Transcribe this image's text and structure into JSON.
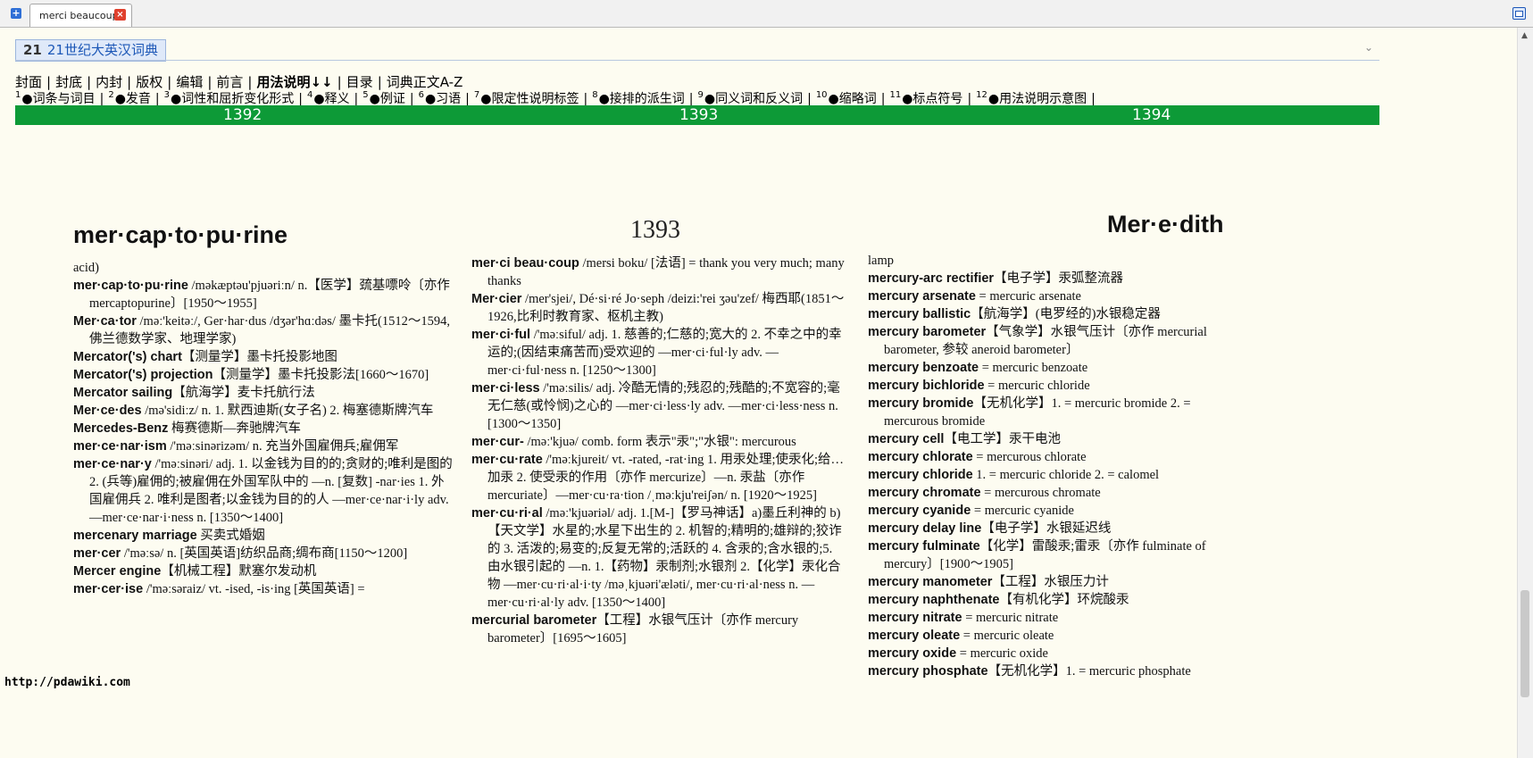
{
  "tab": {
    "label": "merci beaucoup",
    "close_glyph": "×",
    "add_glyph": "+"
  },
  "book": {
    "icon_text": "21",
    "title": "21世纪大英汉词典"
  },
  "nav_main": [
    "封面",
    "封底",
    "内封",
    "版权",
    "编辑",
    "前言",
    "用法说明↓↓",
    "目录",
    "词典正文A-Z"
  ],
  "nav_main_sep": "|",
  "nav_usage": [
    {
      "num": "1",
      "label": "●词条与词目"
    },
    {
      "num": "2",
      "label": "●发音"
    },
    {
      "num": "3",
      "label": "●词性和屈折变化形式"
    },
    {
      "num": "4",
      "label": "●释义"
    },
    {
      "num": "5",
      "label": "●例证"
    },
    {
      "num": "6",
      "label": "●习语"
    },
    {
      "num": "7",
      "label": "●限定性说明标签"
    },
    {
      "num": "8",
      "label": "●接排的派生词"
    },
    {
      "num": "9",
      "label": "●同义词和反义词"
    },
    {
      "num": "10",
      "label": "●缩略词"
    },
    {
      "num": "11",
      "label": "●标点符号"
    },
    {
      "num": "12",
      "label": "●用法说明示意图"
    }
  ],
  "page_numbers": [
    "1392",
    "1393",
    "1394"
  ],
  "pages": [
    {
      "header": "mer·cap·to·pu·rine",
      "entries": [
        {
          "h": "",
          "b": "acid)"
        },
        {
          "h": "mer·cap·to·pu·rine",
          "b": " /məkæptəu'pjuəriːn/ n.【医学】巯基嘌呤〔亦作 mercaptopurine〕[1950～1955]"
        },
        {
          "h": "Mer·ca·tor",
          "b": " /məː'keitəː/, Ger·har·dus /dʒər'hɑːdəs/ 墨卡托(1512～1594,佛兰德数学家、地理学家)"
        },
        {
          "h": "Mercator('s) chart",
          "b": "【测量学】墨卡托投影地图"
        },
        {
          "h": "Mercator('s) projection",
          "b": "【测量学】墨卡托投影法[1660～1670]"
        },
        {
          "h": "Mercator sailing",
          "b": "【航海学】麦卡托航行法"
        },
        {
          "h": "Mer·ce·des",
          "b": " /mə'sidiːz/ n. 1. 默西迪斯(女子名) 2. 梅塞德斯牌汽车"
        },
        {
          "h": "Mercedes-Benz",
          "b": " 梅赛德斯—奔驰牌汽车"
        },
        {
          "h": "mer·ce·nar·ism",
          "b": " /'məːsinərizəm/ n. 充当外国雇佣兵;雇佣军"
        },
        {
          "h": "mer·ce·nar·y",
          "b": " /'məːsinəri/ adj. 1. 以金钱为目的的;贪财的;唯利是图的 2. (兵等)雇佣的;被雇佣在外国军队中的 —n. [复数] -nar·ies 1. 外国雇佣兵 2. 唯利是图者;以金钱为目的的人 —mer·ce·nar·i·ly adv. —mer·ce·nar·i·ness n. [1350～1400]"
        },
        {
          "h": "mercenary marriage",
          "b": " 买卖式婚姻"
        },
        {
          "h": "mer·cer",
          "b": " /'məːsə/ n. [英国英语]纺织品商;绸布商[1150～1200]"
        },
        {
          "h": "Mercer engine",
          "b": "【机械工程】默塞尔发动机"
        },
        {
          "h": "mer·cer·ise",
          "b": " /'məːsəraiz/ vt. -ised, -is·ing [英国英语] ="
        }
      ]
    },
    {
      "header": "1393",
      "entries": [
        {
          "h": "mer·ci beau·coup",
          "b": " /mersi boku/ [法语] = thank you very much; many thanks"
        },
        {
          "h": "Mer·cier",
          "b": " /mer'sjei/, Dé·si·ré Jo·seph /deizi:'rei ʒəu'zef/ 梅西耶(1851～1926,比利时教育家、枢机主教)"
        },
        {
          "h": "mer·ci·ful",
          "b": " /'məːsiful/ adj. 1. 慈善的;仁慈的;宽大的 2. 不幸之中的幸运的;(因结束痛苦而)受欢迎的 —mer·ci·ful·ly adv. —mer·ci·ful·ness n. [1250～1300]"
        },
        {
          "h": "mer·ci·less",
          "b": " /'məːsilis/ adj. 冷酷无情的;残忍的;残酷的;不宽容的;毫无仁慈(或怜悯)之心的 —mer·ci·less·ly adv. —mer·ci·less·ness n. [1300～1350]"
        },
        {
          "h": "mer·cur-",
          "b": " /məː'kjuə/ comb. form 表示\"汞\";\"水银\": mercurous"
        },
        {
          "h": "mer·cu·rate",
          "b": " /'məːkjureit/ vt. -rated, -rat·ing 1. 用汞处理;使汞化;给…加汞 2. 使受汞的作用〔亦作 mercurize〕—n. 汞盐〔亦作 mercuriate〕—mer·cu·ra·tion /ˌməːkju'reiʃən/ n. [1920～1925]"
        },
        {
          "h": "mer·cu·ri·al",
          "b": " /məː'kjuəriəl/ adj. 1.[M-]【罗马神话】a)墨丘利神的 b)【天文学】水星的;水星下出生的 2. 机智的;精明的;雄辩的;狡诈的 3. 活泼的;易变的;反复无常的;活跃的 4. 含汞的;含水银的;5. 由水银引起的 —n. 1.【药物】汞制剂;水银剂 2.【化学】汞化合物 —mer·cu·ri·al·i·ty /məˌkjuəri'æləti/, mer·cu·ri·al·ness n. —mer·cu·ri·al·ly adv. [1350～1400]"
        },
        {
          "h": "mercurial barometer",
          "b": "【工程】水银气压计〔亦作 mercury barometer〕[1695～1605]"
        }
      ]
    },
    {
      "header": "Mer·e·dith",
      "entries": [
        {
          "h": "",
          "b": "lamp"
        },
        {
          "h": "mercury-arc rectifier",
          "b": "【电子学】汞弧整流器"
        },
        {
          "h": "mercury arsenate",
          "b": " = mercuric arsenate"
        },
        {
          "h": "mercury ballistic",
          "b": "【航海学】(电罗经的)水银稳定器"
        },
        {
          "h": "mercury barometer",
          "b": "【气象学】水银气压计〔亦作 mercurial barometer, 参较 aneroid barometer〕"
        },
        {
          "h": "mercury benzoate",
          "b": " = mercuric benzoate"
        },
        {
          "h": "mercury bichloride",
          "b": " = mercuric chloride"
        },
        {
          "h": "mercury bromide",
          "b": "【无机化学】1. = mercuric bromide 2. = mercurous bromide"
        },
        {
          "h": "mercury cell",
          "b": "【电工学】汞干电池"
        },
        {
          "h": "mercury chlorate",
          "b": " = mercurous chlorate"
        },
        {
          "h": "mercury chloride",
          "b": " 1. = mercuric chloride 2. = calomel"
        },
        {
          "h": "mercury chromate",
          "b": " = mercurous chromate"
        },
        {
          "h": "mercury cyanide",
          "b": " = mercuric cyanide"
        },
        {
          "h": "mercury delay line",
          "b": "【电子学】水银延迟线"
        },
        {
          "h": "mercury fulminate",
          "b": "【化学】雷酸汞;雷汞〔亦作 fulminate of mercury〕[1900～1905]"
        },
        {
          "h": "mercury manometer",
          "b": "【工程】水银压力计"
        },
        {
          "h": "mercury naphthenate",
          "b": "【有机化学】环烷酸汞"
        },
        {
          "h": "mercury nitrate",
          "b": " = mercuric nitrate"
        },
        {
          "h": "mercury oleate",
          "b": " = mercuric oleate"
        },
        {
          "h": "mercury oxide",
          "b": " = mercuric oxide"
        },
        {
          "h": "mercury phosphate",
          "b": "【无机化学】1. = mercuric phosphate"
        }
      ]
    }
  ],
  "status_url": "http://pdawiki.com"
}
